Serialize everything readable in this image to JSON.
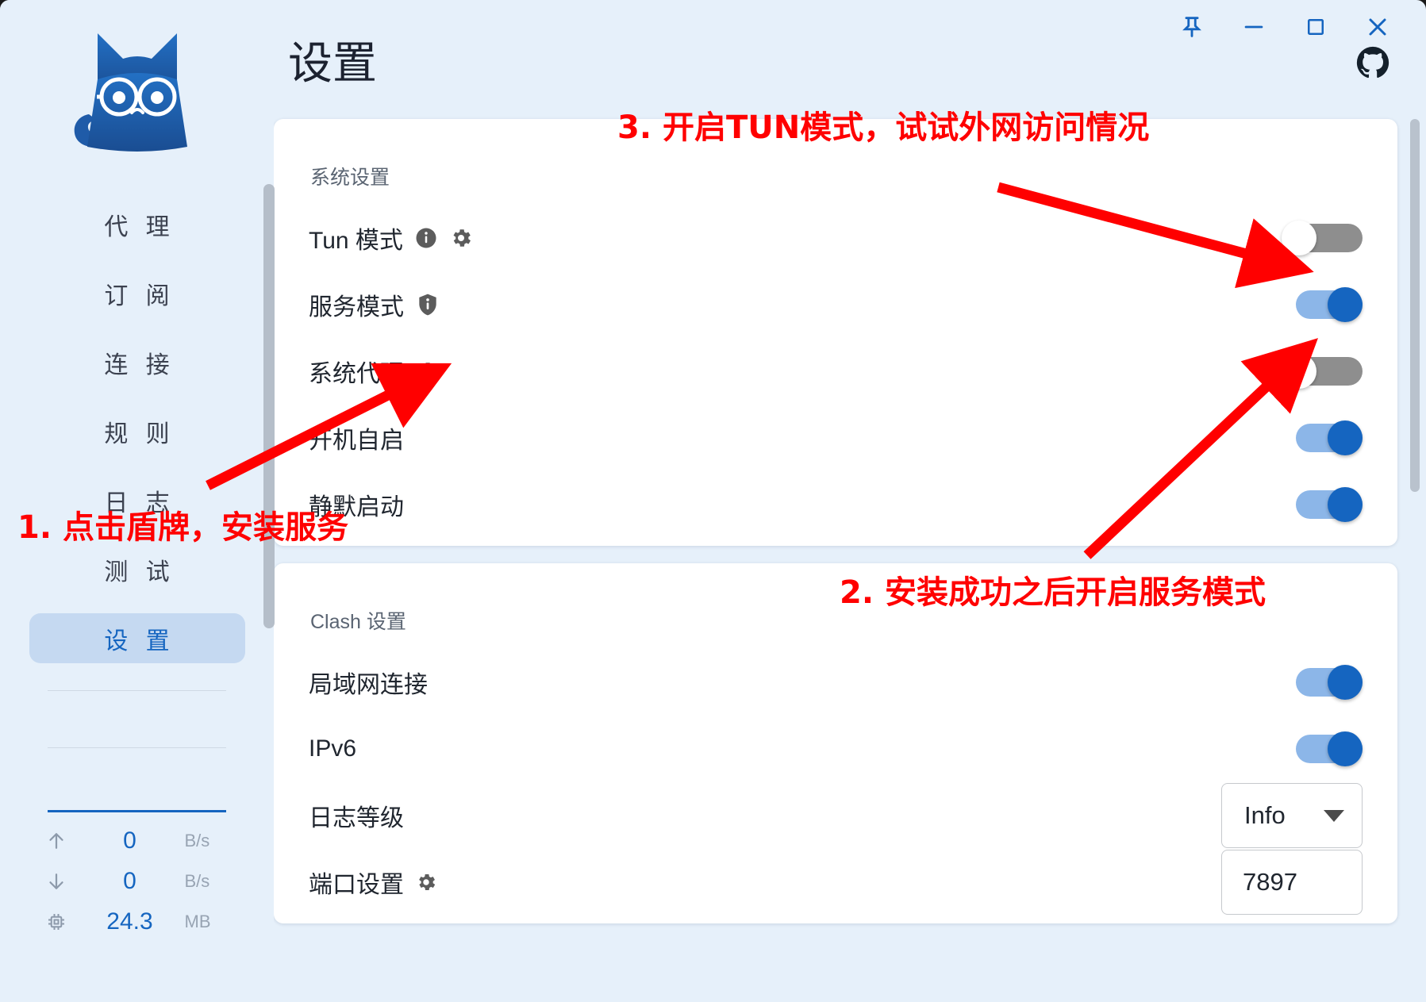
{
  "window": {
    "controls": [
      {
        "name": "pin",
        "label": "固定"
      },
      {
        "name": "minimize",
        "label": "最小化"
      },
      {
        "name": "maximize",
        "label": "最大化"
      },
      {
        "name": "close",
        "label": "关闭"
      }
    ]
  },
  "sidebar": {
    "logo_alt": "Clash Verge 猫咪图标",
    "items": [
      {
        "label": "代 理",
        "active": false
      },
      {
        "label": "订 阅",
        "active": false
      },
      {
        "label": "连 接",
        "active": false
      },
      {
        "label": "规 则",
        "active": false
      },
      {
        "label": "日 志",
        "active": false
      },
      {
        "label": "测 试",
        "active": false
      },
      {
        "label": "设 置",
        "active": true
      }
    ],
    "stats": [
      {
        "icon": "arrow-up-icon",
        "glyph": "↑",
        "value": "0",
        "unit": "B/s"
      },
      {
        "icon": "arrow-down-icon",
        "glyph": "↓",
        "value": "0",
        "unit": "B/s"
      },
      {
        "icon": "chip-icon",
        "glyph": "▣",
        "value": "24.3",
        "unit": "MB"
      }
    ]
  },
  "header": {
    "title": "设置",
    "github_label": "GitHub"
  },
  "system_card": {
    "title": "系统设置",
    "rows": [
      {
        "label": "Tun 模式",
        "icons": [
          "info-icon",
          "gear-icon"
        ],
        "toggle": "off"
      },
      {
        "label": "服务模式",
        "icons": [
          "shield-info-icon"
        ],
        "toggle": "on"
      },
      {
        "label": "系统代理",
        "icons": [
          "gear-icon"
        ],
        "toggle": "off"
      },
      {
        "label": "开机自启",
        "icons": [],
        "toggle": "on"
      },
      {
        "label": "静默启动",
        "icons": [],
        "toggle": "on"
      }
    ]
  },
  "clash_card": {
    "title": "Clash 设置",
    "rows": [
      {
        "label": "局域网连接",
        "control": "toggle",
        "toggle": "on"
      },
      {
        "label": "IPv6",
        "control": "toggle",
        "toggle": "on"
      },
      {
        "label": "日志等级",
        "control": "select",
        "value": "Info"
      },
      {
        "label": "端口设置",
        "control": "field",
        "value": "7897",
        "icons": [
          "gear-icon"
        ]
      }
    ]
  },
  "annotations": [
    {
      "id": "a3",
      "text": "3. 开启TUN模式，试试外网访问情况"
    },
    {
      "id": "a1",
      "text": "1. 点击盾牌，安装服务"
    },
    {
      "id": "a2",
      "text": "2. 安装成功之后开启服务模式"
    }
  ],
  "colors": {
    "accent": "#1565c0",
    "sidebar_bg": "#e6f0fa",
    "active_item_bg": "#c5d9f1",
    "toggle_on_track": "#8cb6e8",
    "toggle_off_track": "#8e8e8e",
    "annotation_red": "#ff0000"
  }
}
